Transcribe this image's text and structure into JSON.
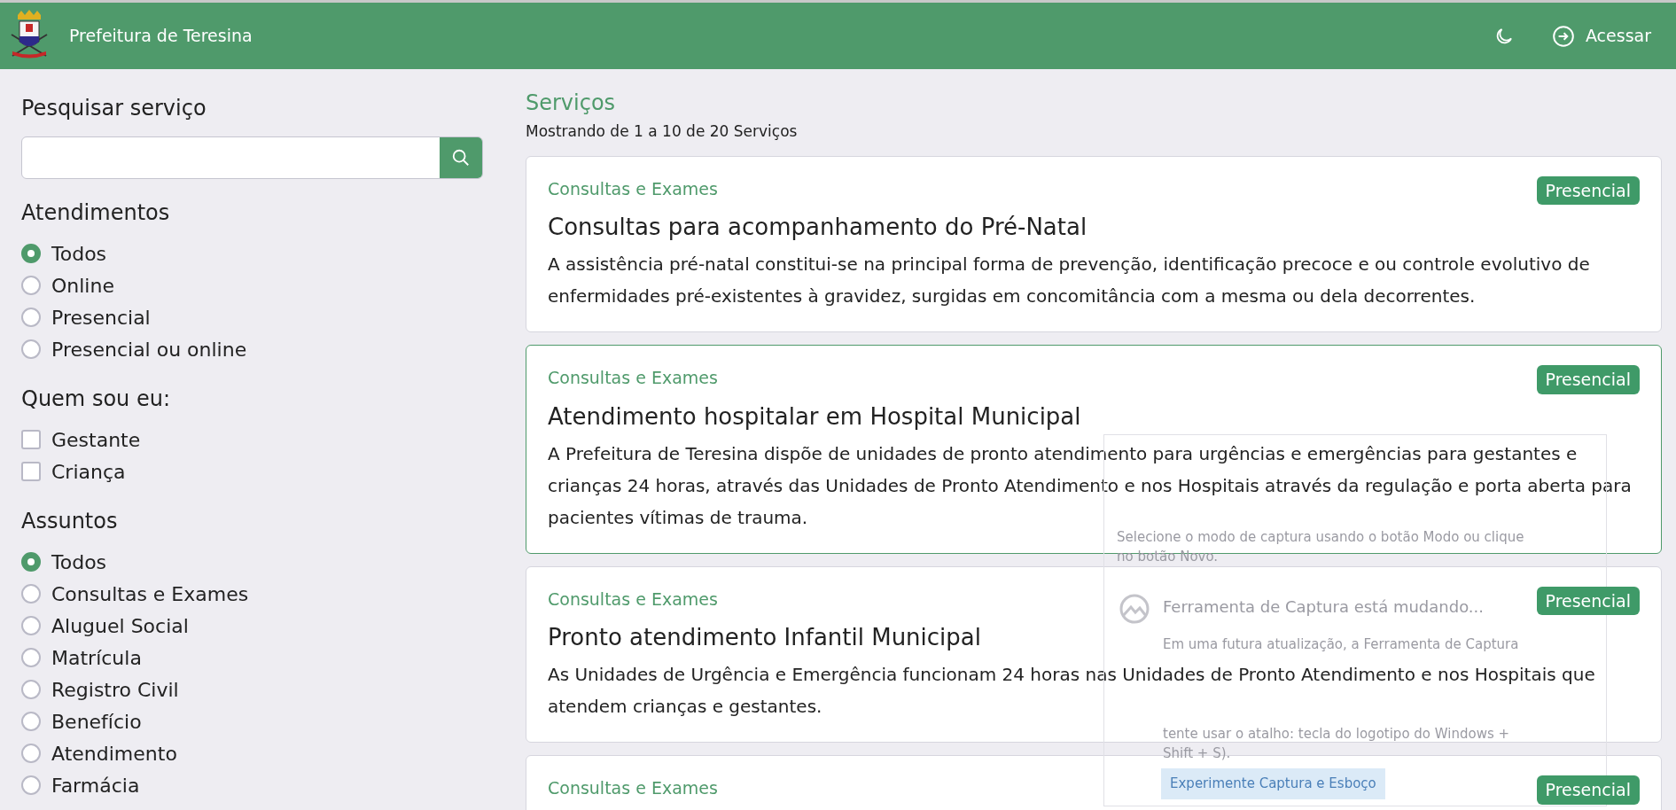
{
  "header": {
    "title": "Prefeitura de Teresina",
    "login": "Acessar"
  },
  "sidebar": {
    "search_title": "Pesquisar serviço",
    "groups": [
      {
        "title": "Atendimentos",
        "kind": "radio",
        "items": [
          {
            "label": "Todos",
            "selected": true
          },
          {
            "label": "Online",
            "selected": false
          },
          {
            "label": "Presencial",
            "selected": false
          },
          {
            "label": "Presencial ou online",
            "selected": false
          }
        ]
      },
      {
        "title": "Quem sou eu:",
        "kind": "checkbox",
        "items": [
          {
            "label": "Gestante",
            "checked": false
          },
          {
            "label": "Criança",
            "checked": false
          }
        ]
      },
      {
        "title": "Assuntos",
        "kind": "radio",
        "items": [
          {
            "label": "Todos",
            "selected": true
          },
          {
            "label": "Consultas e Exames",
            "selected": false
          },
          {
            "label": "Aluguel Social",
            "selected": false
          },
          {
            "label": "Matrícula",
            "selected": false
          },
          {
            "label": "Registro Civil",
            "selected": false
          },
          {
            "label": "Benefício",
            "selected": false
          },
          {
            "label": "Atendimento",
            "selected": false
          },
          {
            "label": "Farmácia",
            "selected": false
          }
        ]
      }
    ]
  },
  "main": {
    "title": "Serviços",
    "subtitle": "Mostrando de 1 a 10 de 20 Serviços",
    "cards": [
      {
        "category": "Consultas e Exames",
        "badge": "Presencial",
        "title": "Consultas para acompanhamento do Pré-Natal",
        "description": "A assistência pré-natal constitui-se na principal forma de prevenção, identificação precoce e ou controle evolutivo de enfermidades pré-existentes à gravidez, surgidas em concomitância com a mesma ou dela decorrentes.",
        "selected": false
      },
      {
        "category": "Consultas e Exames",
        "badge": "Presencial",
        "title": "Atendimento hospitalar em Hospital Municipal",
        "description": "A Prefeitura de Teresina dispõe de unidades de pronto atendimento para urgências e emergências para gestantes e crianças 24 horas, através das Unidades de Pronto Atendimento e nos Hospitais através da regulação e porta aberta para pacientes vítimas de trauma.",
        "selected": true
      },
      {
        "category": "Consultas e Exames",
        "badge": "Presencial",
        "title": "Pronto atendimento Infantil Municipal",
        "description": "As Unidades de Urgência e Emergência funcionam 24 horas nas Unidades de Pronto Atendimento e nos Hospitais que atendem crianças e gestantes.",
        "selected": false
      },
      {
        "category": "Consultas e Exames",
        "badge": "Presencial",
        "selected": false
      }
    ]
  },
  "overlay": {
    "hint": "Selecione o modo de captura usando o botão Modo ou clique no botão Novo.",
    "heading": "Ferramenta de Captura está mudando...",
    "text_top": "Em uma futura atualização, a Ferramenta de Captura",
    "text_bottom": "tente usar o atalho: tecla do logotipo do Windows + Shift + S).",
    "button": "Experimente Captura e Esboço"
  }
}
